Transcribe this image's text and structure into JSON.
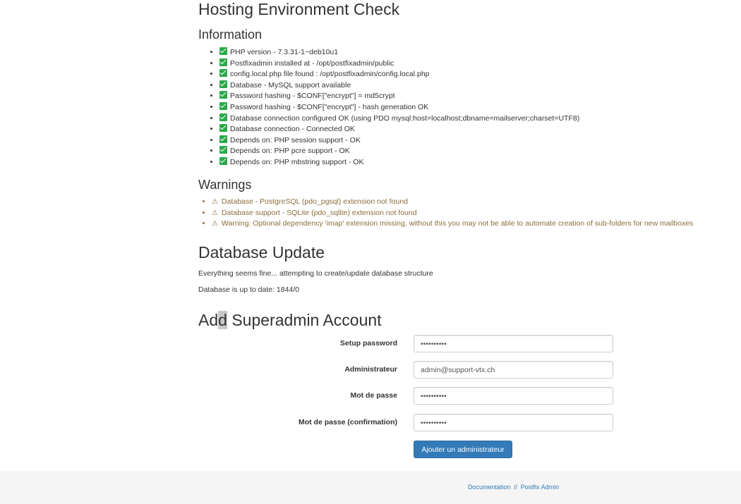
{
  "page_title": "Hosting Environment Check",
  "information": {
    "heading": "Information",
    "items": [
      "PHP version - 7.3.31-1~deb10u1",
      "Postfixadmin installed at - /opt/postfixadmin/public",
      "config.local.php file found : /opt/postfixadmin/config.local.php",
      "Database - MySQL support available",
      "Password hashing - $CONF[\"encrypt\"] = md5crypt",
      "Password hashing - $CONF[\"encrypt\"] - hash generation OK",
      "Database connection configured OK (using PDO mysql:host=localhost;dbname=mailserver;charset=UTF8)",
      "Database connection - Connected OK",
      "Depends on: PHP session support - OK",
      "Depends on: PHP pcre support - OK",
      "Depends on: PHP mbstring support - OK"
    ]
  },
  "warnings": {
    "heading": "Warnings",
    "icon": "⚠",
    "items": [
      "Database - PostgreSQL (pdo_pgsql) extension not found",
      "Database support - SQLite (pdo_sqlite) extension not found",
      "Warning: Optional dependency 'imap' extension missing, without this you may not be able to automate creation of sub-folders for new mailboxes"
    ]
  },
  "database_update": {
    "heading": "Database Update",
    "message1": "Everything seems fine... attempting to create/update database structure",
    "message2": "Database is up to date: 1844/0"
  },
  "superadmin": {
    "heading_pre": "Ad",
    "heading_hl": "d",
    "heading_post": " Superadmin Account",
    "fields": {
      "setup_password": {
        "label": "Setup password",
        "value": "••••••••••"
      },
      "administrator": {
        "label": "Administrateur",
        "value": "admin@support-vtx.ch"
      },
      "password": {
        "label": "Mot de passe",
        "value": "••••••••••"
      },
      "password_confirm": {
        "label": "Mot de passe (confirmation)",
        "value": "••••••••••"
      }
    },
    "submit_label": "Ajouter un administrateur"
  },
  "footer": {
    "documentation": "Documentation",
    "separator": "//",
    "postfix_admin": "Postfix Admin"
  },
  "colors": {
    "ok_green": "#2aa84a",
    "warning_text": "#8a6d3b",
    "primary_button": "#337ab7",
    "footer_bg": "#f5f5f5"
  }
}
